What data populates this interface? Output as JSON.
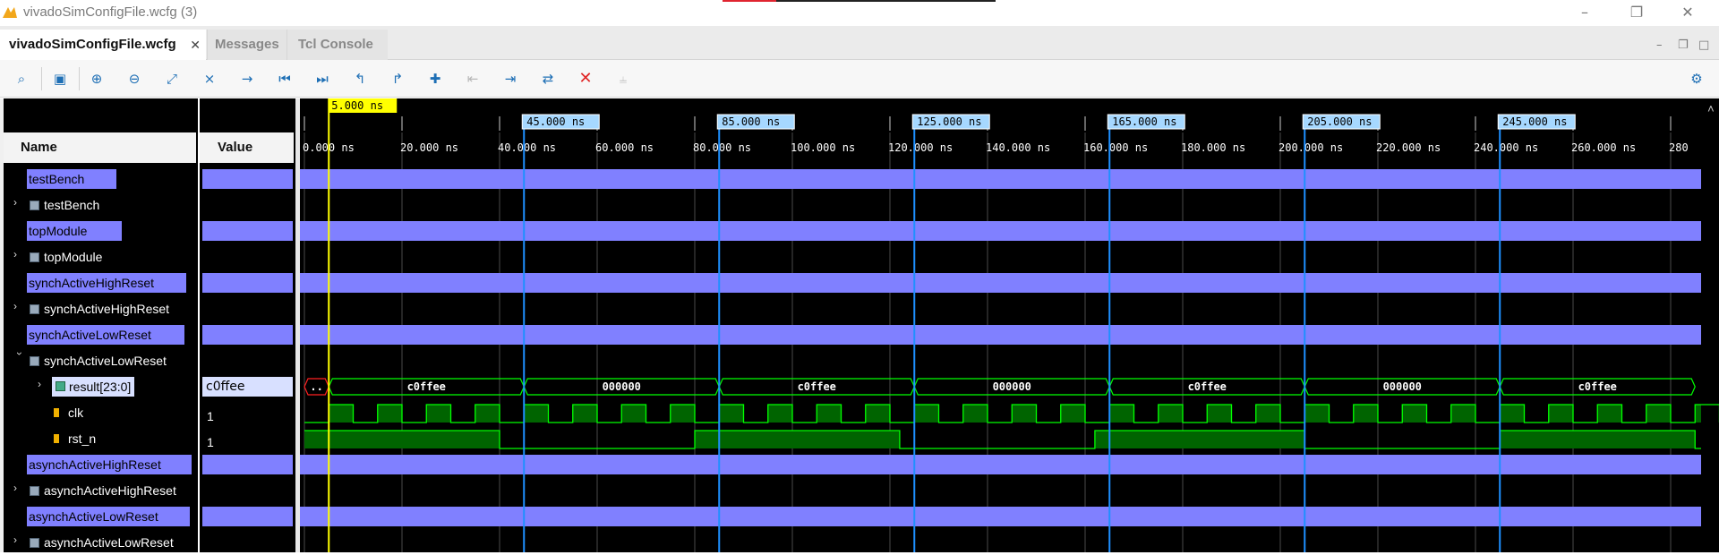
{
  "window": {
    "title": "vivadoSimConfigFile.wcfg (3)"
  },
  "tabs": [
    {
      "label": "vivadoSimConfigFile.wcfg",
      "active": true
    },
    {
      "label": "Messages",
      "active": false
    },
    {
      "label": "Tcl Console",
      "active": false
    }
  ],
  "columns": {
    "name": "Name",
    "value": "Value"
  },
  "rows": [
    {
      "name": "testBench",
      "kind": "group"
    },
    {
      "name": "testBench",
      "kind": "scope"
    },
    {
      "name": "topModule",
      "kind": "group"
    },
    {
      "name": "topModule",
      "kind": "scope"
    },
    {
      "name": "synchActiveHighReset",
      "kind": "group"
    },
    {
      "name": "synchActiveHighReset",
      "kind": "scope"
    },
    {
      "name": "synchActiveLowReset",
      "kind": "group"
    },
    {
      "name": "synchActiveLowReset",
      "kind": "scope-open"
    },
    {
      "name": "result[23:0]",
      "kind": "bus",
      "value": "c0ffee"
    },
    {
      "name": "clk",
      "kind": "bit",
      "value": "1"
    },
    {
      "name": "rst_n",
      "kind": "bit",
      "value": "1"
    },
    {
      "name": "asynchActiveHighReset",
      "kind": "group"
    },
    {
      "name": "asynchActiveHighReset",
      "kind": "scope"
    },
    {
      "name": "asynchActiveLowReset",
      "kind": "group"
    },
    {
      "name": "asynchActiveLowReset",
      "kind": "scope"
    }
  ],
  "cursor": {
    "label": "5.000 ns"
  },
  "markers": [
    {
      "label": "45.000 ns"
    },
    {
      "label": "85.000 ns"
    },
    {
      "label": "125.000 ns"
    },
    {
      "label": "165.000 ns"
    },
    {
      "label": "205.000 ns"
    },
    {
      "label": "245.000 ns"
    }
  ],
  "ruler_ticks": [
    "0.000 ns",
    "20.000 ns",
    "40.000 ns",
    "60.000 ns",
    "80.000 ns",
    "100.000 ns",
    "120.000 ns",
    "140.000 ns",
    "160.000 ns",
    "180.000 ns",
    "200.000 ns",
    "220.000 ns",
    "240.000 ns",
    "260.000 ns",
    "280"
  ],
  "bus_segments": [
    "..",
    "c0ffee",
    "000000",
    "c0ffee",
    "000000",
    "c0ffee",
    "000000",
    "c0ffee"
  ],
  "colors": {
    "group_fill": "#8080ff",
    "signal": "#00ff00",
    "signal_fill": "#006400",
    "cursor": "#ffff00",
    "marker": "#1e90ff",
    "marker_label_bg": "#a6d8ff"
  },
  "toolbar_icons": [
    "search-icon",
    "save-icon",
    "zoom-in-icon",
    "zoom-out-icon",
    "zoom-fit-icon",
    "cursor-to-zero-icon",
    "go-to-cursor-icon",
    "go-to-time-zero-icon",
    "go-to-last-time-icon",
    "previous-transition-icon",
    "next-transition-icon",
    "add-marker-icon",
    "previous-marker-icon",
    "next-marker-icon",
    "swap-cursors-icon",
    "delete-icon",
    "snap-icon",
    "settings-icon"
  ]
}
